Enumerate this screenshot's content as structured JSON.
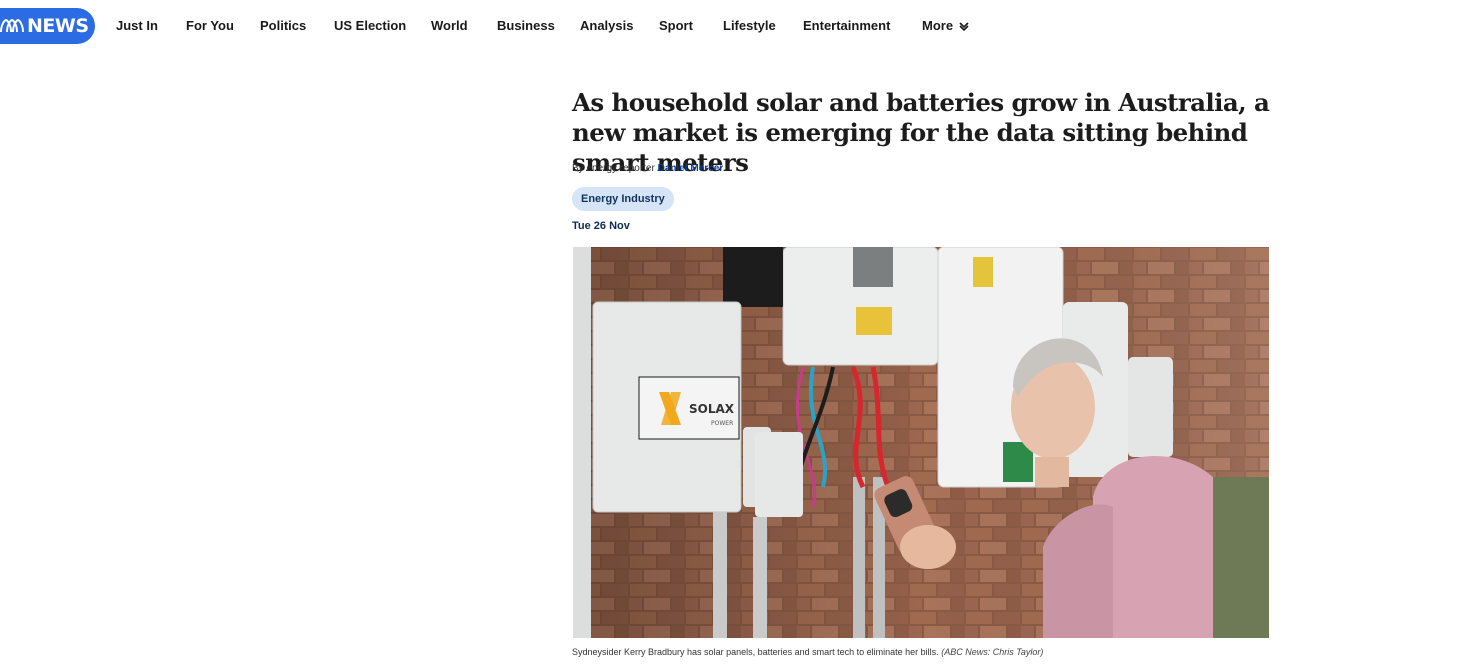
{
  "brand": {
    "name": "NEWS",
    "primary": "#2b6be3"
  },
  "nav": {
    "items": [
      "Just In",
      "For You",
      "Politics",
      "US Election",
      "World",
      "Business",
      "Analysis",
      "Sport",
      "Lifestyle",
      "Entertainment"
    ],
    "more_label": "More"
  },
  "article": {
    "headline": "As household solar and batteries grow in Australia, a new market is emerging for the data sitting behind smart meters",
    "byline_prefix": "By energy reporter",
    "author": "Daniel Mercer",
    "tag": "Energy Industry",
    "date": "Tue 26 Nov",
    "image": {
      "caption": "Sydneysider Kerry Bradbury has solar panels, batteries and smart tech to eliminate her bills.",
      "credit": "(ABC News: Chris Taylor)",
      "inverter_brand": "SOLAX",
      "inverter_sub": "POWER"
    }
  }
}
